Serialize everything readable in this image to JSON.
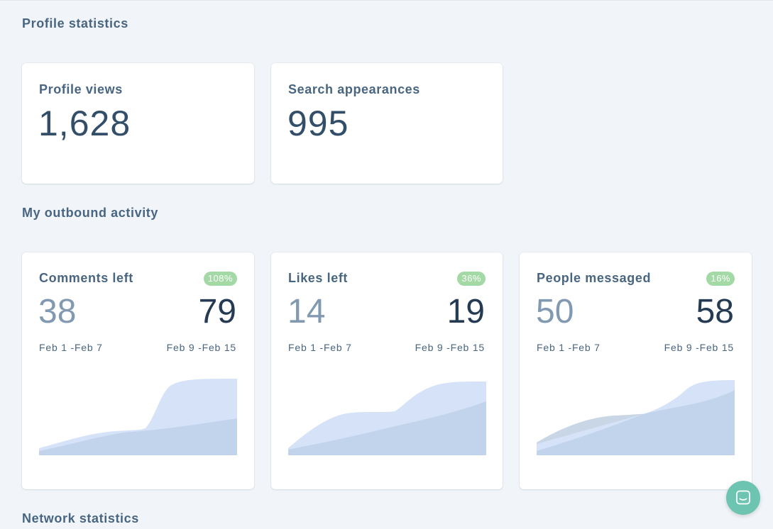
{
  "sections": {
    "profile_statistics": "Profile statistics",
    "outbound_activity": "My outbound activity",
    "network_statistics": "Network statistics"
  },
  "profile_stats": [
    {
      "label": "Profile views",
      "value": "1,628"
    },
    {
      "label": "Search appearances",
      "value": "995"
    }
  ],
  "activity": [
    {
      "label": "Comments left",
      "change": "108%",
      "prev_value": "38",
      "curr_value": "79",
      "prev_range": "Feb 1 -Feb 7",
      "curr_range": "Feb 9 -Feb 15"
    },
    {
      "label": "Likes left",
      "change": "36%",
      "prev_value": "14",
      "curr_value": "19",
      "prev_range": "Feb 1 -Feb 7",
      "curr_range": "Feb 9 -Feb 15"
    },
    {
      "label": "People messaged",
      "change": "16%",
      "prev_value": "50",
      "curr_value": "58",
      "prev_range": "Feb 1 -Feb 7",
      "curr_range": "Feb 9 -Feb 15"
    }
  ],
  "colors": {
    "badge": "#a3d9a5",
    "chart_current": "#d6e2f7",
    "chart_previous": "#c2d3ec",
    "chat_launcher": "#6cc4b1"
  },
  "icons": {
    "chat_launcher": "chat-bubble-icon"
  }
}
